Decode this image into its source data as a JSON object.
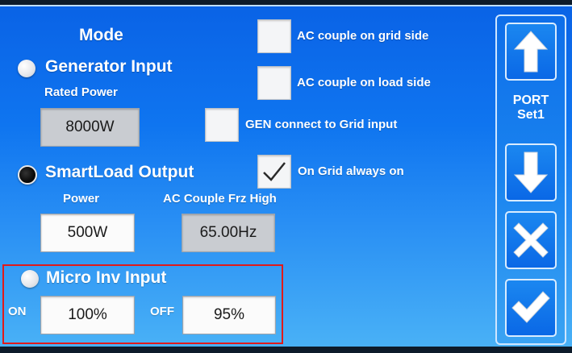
{
  "mode": {
    "title": "Mode",
    "generator": {
      "label": "Generator Input",
      "rated_power_label": "Rated Power",
      "rated_power_value": "8000W",
      "selected": false
    },
    "smartload": {
      "label": "SmartLoad Output",
      "power_label": "Power",
      "power_value": "500W",
      "freq_label": "AC Couple Frz High",
      "freq_value": "65.00Hz",
      "selected": true
    },
    "micro_inv": {
      "label": "Micro Inv Input",
      "on_label": "ON",
      "on_value": "100%",
      "off_label": "OFF",
      "off_value": "95%",
      "selected": false
    }
  },
  "options": [
    {
      "label": "AC couple on grid side",
      "checked": false
    },
    {
      "label": "AC couple on load side",
      "checked": false
    },
    {
      "label": "GEN connect to Grid input",
      "checked": false
    },
    {
      "label": "On Grid always on",
      "checked": true
    }
  ],
  "sidebar": {
    "port_line1": "PORT",
    "port_line2": "Set1"
  },
  "colors": {
    "highlight": "#e11a1a",
    "accent": "#0a63e6"
  }
}
